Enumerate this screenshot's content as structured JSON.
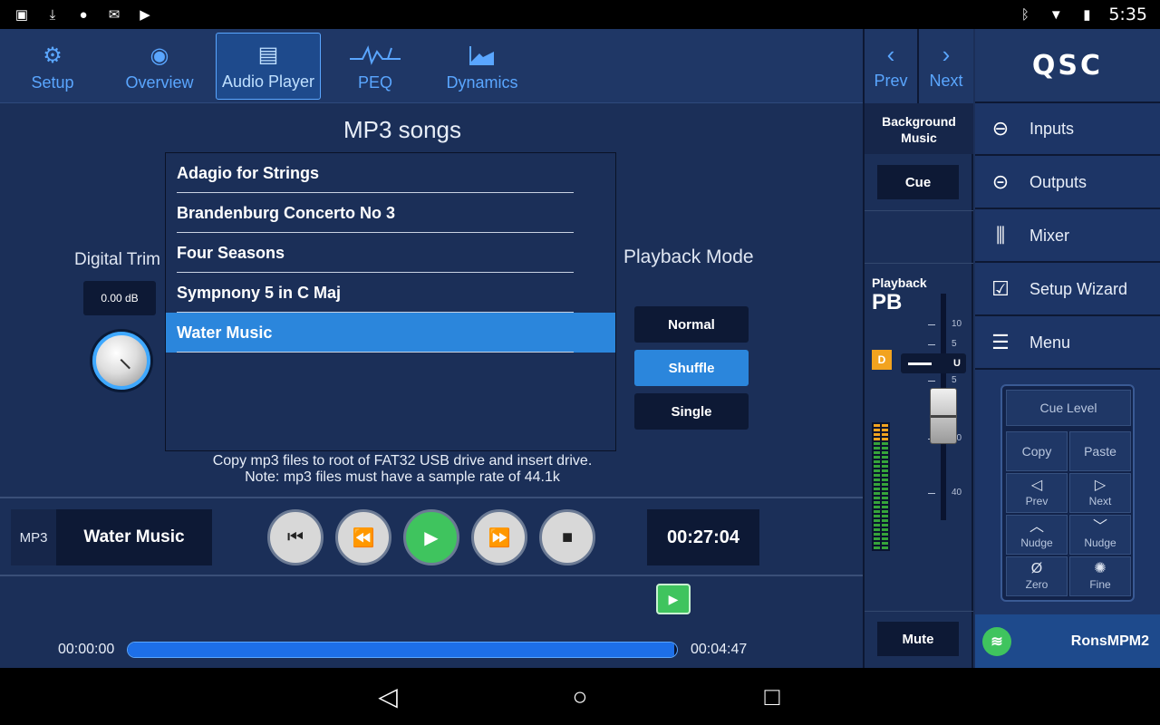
{
  "statusbar": {
    "time": "5:35",
    "left_icons": [
      "image-icon",
      "download-icon",
      "alert-icon",
      "mail-icon",
      "play-store-icon"
    ],
    "right_icons": [
      "bluetooth-icon",
      "wifi-icon",
      "battery-icon"
    ]
  },
  "tabs": [
    {
      "label": "Setup",
      "icon": "gear-icon",
      "active": false
    },
    {
      "label": "Overview",
      "icon": "eye-icon",
      "active": false
    },
    {
      "label": "Audio Player",
      "icon": "speaker-icon",
      "active": true
    },
    {
      "label": "PEQ",
      "icon": "peq-curve-icon",
      "active": false
    },
    {
      "label": "Dynamics",
      "icon": "dynamics-icon",
      "active": false
    }
  ],
  "nav": {
    "prev": "Prev",
    "next": "Next"
  },
  "player": {
    "title": "MP3 songs",
    "songs": [
      {
        "name": "Adagio for Strings",
        "selected": false
      },
      {
        "name": "Brandenburg Concerto No 3",
        "selected": false
      },
      {
        "name": "Four Seasons",
        "selected": false
      },
      {
        "name": "Sympnony 5 in C Maj",
        "selected": false
      },
      {
        "name": "Water Music",
        "selected": true
      }
    ],
    "digital_trim": {
      "label": "Digital Trim",
      "value": "0.00 dB"
    },
    "playback_mode": {
      "label": "Playback Mode",
      "options": [
        "Normal",
        "Shuffle",
        "Single"
      ],
      "selected": "Shuffle"
    },
    "note_line1": "Copy mp3 files to root of FAT32 USB drive and insert drive.",
    "note_line2": "Note: mp3 files must have a sample rate of 44.1k",
    "source_label": "MP3",
    "now_playing": "Water Music",
    "elapsed": "00:27:04",
    "start_time": "00:00:00",
    "end_time": "00:04:47",
    "progress_fraction": 0.995
  },
  "strip": {
    "name_line1": "Background",
    "name_line2": "Music",
    "cue": "Cue",
    "channel_small": "Playback",
    "channel_big": "PB",
    "badge": "D",
    "unity_label": "U",
    "scale": [
      "10",
      "5",
      "5",
      "10",
      "40"
    ],
    "mute": "Mute"
  },
  "sidebar": {
    "brand": "QSC",
    "items": [
      {
        "label": "Inputs",
        "icon": "inputs-icon"
      },
      {
        "label": "Outputs",
        "icon": "outputs-icon"
      },
      {
        "label": "Mixer",
        "icon": "mixer-icon"
      },
      {
        "label": "Setup Wizard",
        "icon": "wizard-icon"
      },
      {
        "label": "Menu",
        "icon": "menu-icon"
      }
    ],
    "keypad": {
      "cue_level": "Cue Level",
      "copy": "Copy",
      "paste": "Paste",
      "prev": "Prev",
      "next": "Next",
      "nudge_up": "Nudge",
      "nudge_down": "Nudge",
      "zero": "Zero",
      "fine": "Fine"
    },
    "connection": "RonsMPM2"
  },
  "colors": {
    "accent": "#5aa6ff",
    "selected": "#2b86dc",
    "play": "#3fc45e",
    "background": "#1b2f58",
    "badge": "#f2a31f"
  }
}
